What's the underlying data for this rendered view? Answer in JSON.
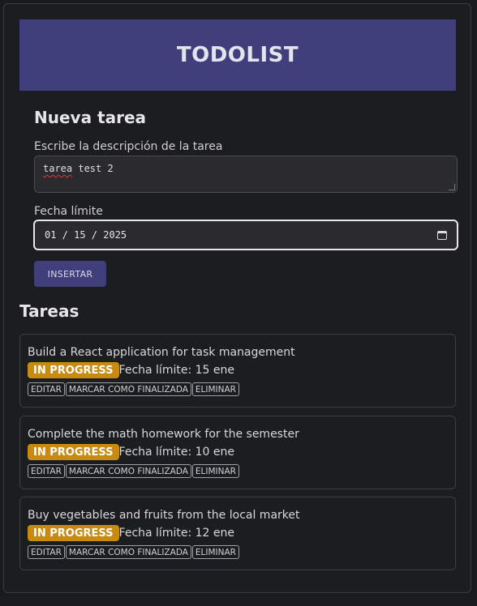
{
  "app": {
    "title": "TODOLIST"
  },
  "form": {
    "title": "Nueva tarea",
    "description_label": "Escribe la descripción de la tarea",
    "description_value_word1": "tarea",
    "description_value_rest": " test 2",
    "date_label": "Fecha límite",
    "date_value": "01 / 15 / 2025",
    "insert_label": "INSERTAR"
  },
  "list": {
    "title": "Tareas",
    "tasks": [
      {
        "description": "Build a React application for task management",
        "status": "IN PROGRESS",
        "due": "Fecha límite: 15 ene"
      },
      {
        "description": "Complete the math homework for the semester",
        "status": "IN PROGRESS",
        "due": "Fecha límite: 10 ene"
      },
      {
        "description": "Buy vegetables and fruits from the local market",
        "status": "IN PROGRESS",
        "due": "Fecha límite: 12 ene"
      }
    ],
    "actions": {
      "edit": "EDITAR",
      "finish": "MARCAR COMO FINALIZADA",
      "delete": "ELIMINAR"
    }
  },
  "colors": {
    "header_bg": "#403f7b",
    "badge_bg": "#c98a12",
    "page_bg": "#1a1b1e"
  },
  "icons": {
    "date_picker": "calendar-icon"
  }
}
